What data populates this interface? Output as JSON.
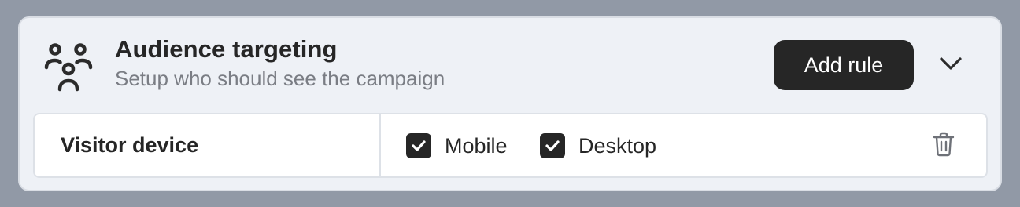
{
  "panel": {
    "icon": "users-group-icon",
    "title": "Audience targeting",
    "subtitle": "Setup who should see the campaign",
    "add_rule_label": "Add rule",
    "collapse_icon": "chevron-down-icon"
  },
  "rule": {
    "label": "Visitor device",
    "options": [
      {
        "label": "Mobile",
        "checked": true
      },
      {
        "label": "Desktop",
        "checked": true
      }
    ],
    "delete_icon": "trash-icon"
  },
  "colors": {
    "background": "#9199a6",
    "panel": "#eef1f6",
    "button": "#262626",
    "checkbox": "#262626",
    "subtitle": "#7a7d84"
  }
}
